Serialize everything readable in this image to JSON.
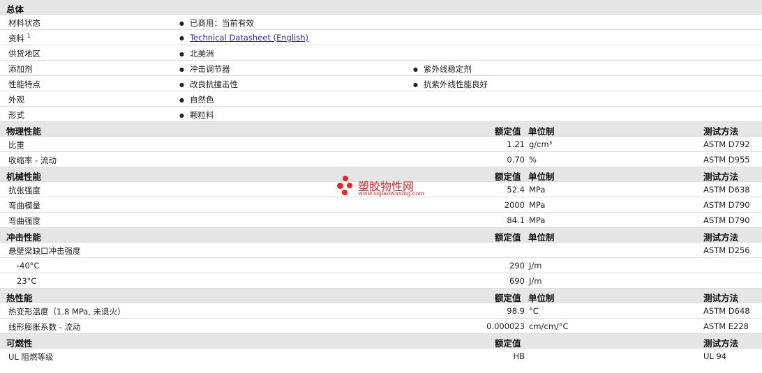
{
  "general": {
    "title": "总体",
    "rows": [
      {
        "label": "材料状态",
        "values": [
          "已商用：当前有效"
        ]
      },
      {
        "label": "资料",
        "sup": "1",
        "link": "Technical Datasheet (English)"
      },
      {
        "label": "供货地区",
        "values": [
          "北美洲"
        ]
      },
      {
        "label": "添加剂",
        "values": [
          "冲击调节器",
          "紫外线稳定剂"
        ]
      },
      {
        "label": "性能特点",
        "values": [
          "改良抗撞击性",
          "抗紫外线性能良好"
        ]
      },
      {
        "label": "外观",
        "values": [
          "自然色"
        ]
      },
      {
        "label": "形式",
        "values": [
          "颗粒料"
        ]
      }
    ]
  },
  "columns": {
    "nominal": "额定值",
    "unit": "单位制",
    "method": "测试方法"
  },
  "physical": {
    "title": "物理性能",
    "rows": [
      {
        "label": "比重",
        "value": "1.21",
        "unit": "g/cm³",
        "method": "ASTM D792"
      },
      {
        "label": "收缩率  - 流动",
        "value": "0.70",
        "unit": "%",
        "method": "ASTM D955"
      }
    ]
  },
  "mechanical": {
    "title": "机械性能",
    "rows": [
      {
        "label": "抗张强度",
        "value": "52.4",
        "unit": "MPa",
        "method": "ASTM D638"
      },
      {
        "label": "弯曲模量",
        "value": "2000",
        "unit": "MPa",
        "method": "ASTM D790"
      },
      {
        "label": "弯曲强度",
        "value": "84.1",
        "unit": "MPa",
        "method": "ASTM D790"
      }
    ]
  },
  "impact": {
    "title": "冲击性能",
    "rows": [
      {
        "label": "悬壁梁缺口冲击强度",
        "value": "",
        "unit": "",
        "method": "ASTM D256"
      },
      {
        "label": "-40°C",
        "value": "290",
        "unit": "J/m",
        "method": ""
      },
      {
        "label": "23°C",
        "value": "690",
        "unit": "J/m",
        "method": ""
      }
    ]
  },
  "thermal": {
    "title": "热性能",
    "rows": [
      {
        "label": "热变形温度（1.8 MPa, 未退火）",
        "value": "98.9",
        "unit": "°C",
        "method": "ASTM D648"
      },
      {
        "label": "线形膨胀系数  - 流动",
        "value": "0.000023",
        "unit": "cm/cm/°C",
        "method": "ASTM E228"
      }
    ]
  },
  "flammability": {
    "title": "可燃性",
    "rows": [
      {
        "label": "UL 阻燃等级",
        "value": "HB",
        "unit": "",
        "method": "UL 94"
      }
    ]
  },
  "watermark": {
    "name": "塑胶物性网",
    "url": "www.sujiaowuxing.com",
    "color": "#e02020"
  }
}
